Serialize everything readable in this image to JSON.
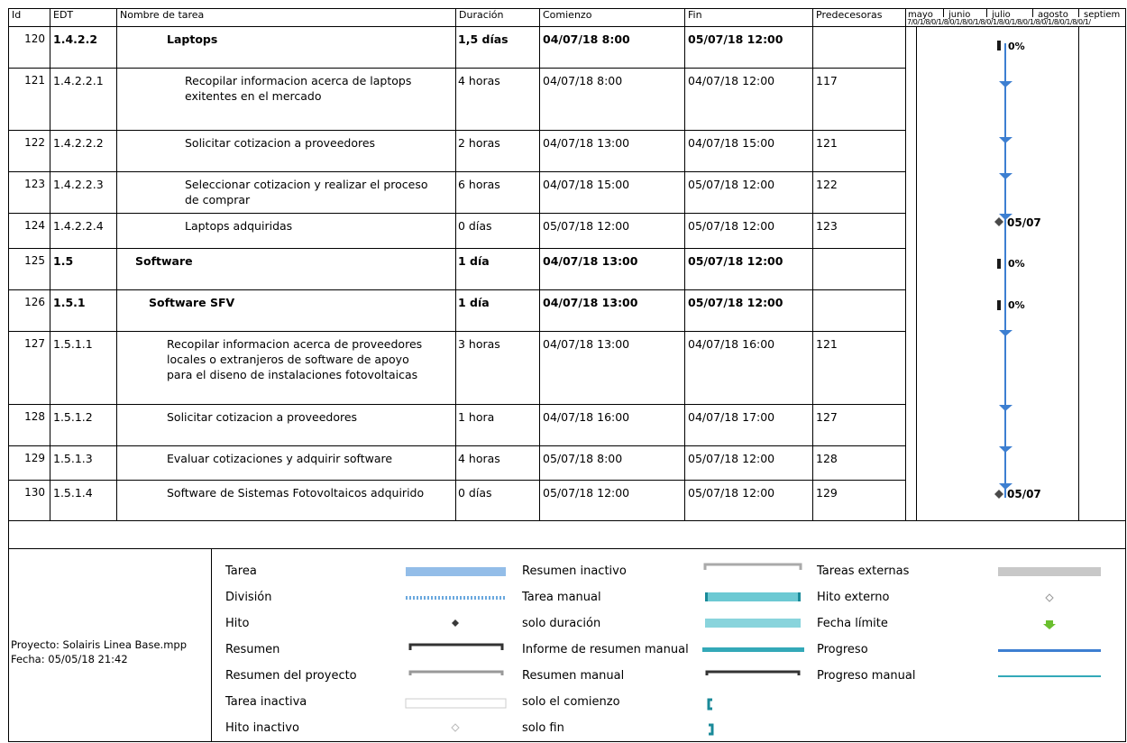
{
  "columns": {
    "id": "Id",
    "edt": "EDT",
    "name": "Nombre de tarea",
    "duration": "Duración",
    "start": "Comienzo",
    "end": "Fin",
    "pred": "Predecesoras"
  },
  "timeline": {
    "months": [
      "mayo",
      "junio",
      "julio",
      "agosto",
      "septiem"
    ],
    "subticks": "7/0/1/8/0/1/8/0/1/8/0/1/8/0/1/8/0/1/8/0/1/8/0/1/8/0/1/8/0/1/"
  },
  "rows": [
    {
      "id": "120",
      "edt": "1.4.2.2",
      "name": "Laptops",
      "duration": "1,5 días",
      "start": "04/07/18 8:00",
      "end": "05/07/18 12:00",
      "pred": "",
      "bold": true,
      "gantt": "0%"
    },
    {
      "id": "121",
      "edt": "1.4.2.2.1",
      "name": "Recopilar informacion acerca de laptops",
      "name2": "exitentes en el mercado",
      "duration": "4 horas",
      "start": "04/07/18 8:00",
      "end": "04/07/18 12:00",
      "pred": "117"
    },
    {
      "id": "122",
      "edt": "1.4.2.2.2",
      "name": "Solicitar cotizacion a proveedores",
      "duration": "2 horas",
      "start": "04/07/18 13:00",
      "end": "04/07/18 15:00",
      "pred": "121"
    },
    {
      "id": "123",
      "edt": "1.4.2.2.3",
      "name": "Seleccionar cotizacion y realizar el proceso",
      "name2": "de comprar",
      "duration": "6 horas",
      "start": "04/07/18 15:00",
      "end": "05/07/18 12:00",
      "pred": "122"
    },
    {
      "id": "124",
      "edt": "1.4.2.2.4",
      "name": "Laptops adquiridas",
      "duration": "0 días",
      "start": "05/07/18 12:00",
      "end": "05/07/18 12:00",
      "pred": "123",
      "gantt": "05/07"
    },
    {
      "id": "125",
      "edt": "1.5",
      "name": "Software",
      "duration": "1 día",
      "start": "04/07/18 13:00",
      "end": "05/07/18 12:00",
      "pred": "",
      "bold": true,
      "gantt": "0%"
    },
    {
      "id": "126",
      "edt": "1.5.1",
      "name": "Software SFV",
      "duration": "1 día",
      "start": "04/07/18 13:00",
      "end": "05/07/18 12:00",
      "pred": "",
      "bold": true,
      "gantt": "0%"
    },
    {
      "id": "127",
      "edt": "1.5.1.1",
      "name": "Recopilar informacion acerca de proveedores",
      "name2": "locales o extranjeros de software de apoyo",
      "name3": "para el diseno de instalaciones fotovoltaicas",
      "duration": "3 horas",
      "start": "04/07/18 13:00",
      "end": "04/07/18 16:00",
      "pred": "121"
    },
    {
      "id": "128",
      "edt": "1.5.1.2",
      "name": "Solicitar cotizacion a proveedores",
      "duration": "1 hora",
      "start": "04/07/18 16:00",
      "end": "04/07/18 17:00",
      "pred": "127"
    },
    {
      "id": "129",
      "edt": "1.5.1.3",
      "name": "Evaluar cotizaciones y adquirir software",
      "duration": "4 horas",
      "start": "05/07/18 8:00",
      "end": "05/07/18 12:00",
      "pred": "128"
    },
    {
      "id": "130",
      "edt": "1.5.1.4",
      "name": "Software de Sistemas Fotovoltaicos adquirido",
      "duration": "0 días",
      "start": "05/07/18 12:00",
      "end": "05/07/18 12:00",
      "pred": "129",
      "gantt": "05/07"
    }
  ],
  "footer": {
    "project": "Proyecto: Solairis Linea Base.mpp",
    "date": "Fecha: 05/05/18 21:42"
  },
  "legend": {
    "col1": [
      "Tarea",
      "División",
      "Hito",
      "Resumen",
      "Resumen del proyecto",
      "Tarea inactiva",
      "Hito inactivo"
    ],
    "col2": [
      "Resumen inactivo",
      "Tarea manual",
      "solo duración",
      "Informe de resumen manual",
      "Resumen manual",
      "solo el comienzo",
      "solo fin"
    ],
    "col3": [
      "Tareas externas",
      "Hito externo",
      "Fecha límite",
      "Progreso",
      "Progreso manual"
    ]
  },
  "colors": {
    "task_bar": "#93bde8",
    "manual_task": "#6cc9d3",
    "progress": "#3d7fd1",
    "progress_manual": "#33a9b8",
    "deadline": "#6abf2e",
    "external": "#c8c8c8"
  }
}
